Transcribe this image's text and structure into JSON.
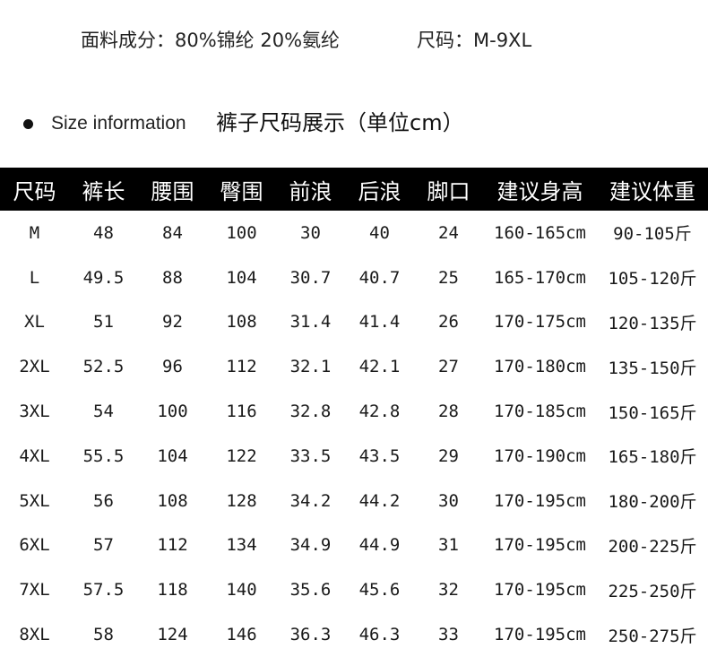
{
  "header": {
    "fabric": "面料成分：80%锦纶  20%氨纶",
    "size_range": "尺码：M-9XL"
  },
  "info": {
    "english": "Size information",
    "chinese": "裤子尺码展示（单位cm）"
  },
  "table": {
    "columns": [
      "尺码",
      "裤长",
      "腰围",
      "臀围",
      "前浪",
      "后浪",
      "脚口",
      "建议身高",
      "建议体重"
    ],
    "rows": [
      [
        "M",
        "48",
        "84",
        "100",
        "30",
        "40",
        "24",
        "160-165cm",
        "90-105斤"
      ],
      [
        "L",
        "49.5",
        "88",
        "104",
        "30.7",
        "40.7",
        "25",
        "165-170cm",
        "105-120斤"
      ],
      [
        "XL",
        "51",
        "92",
        "108",
        "31.4",
        "41.4",
        "26",
        "170-175cm",
        "120-135斤"
      ],
      [
        "2XL",
        "52.5",
        "96",
        "112",
        "32.1",
        "42.1",
        "27",
        "170-180cm",
        "135-150斤"
      ],
      [
        "3XL",
        "54",
        "100",
        "116",
        "32.8",
        "42.8",
        "28",
        "170-185cm",
        "150-165斤"
      ],
      [
        "4XL",
        "55.5",
        "104",
        "122",
        "33.5",
        "43.5",
        "29",
        "170-190cm",
        "165-180斤"
      ],
      [
        "5XL",
        "56",
        "108",
        "128",
        "34.2",
        "44.2",
        "30",
        "170-195cm",
        "180-200斤"
      ],
      [
        "6XL",
        "57",
        "112",
        "134",
        "34.9",
        "44.9",
        "31",
        "170-195cm",
        "200-225斤"
      ],
      [
        "7XL",
        "57.5",
        "118",
        "140",
        "35.6",
        "45.6",
        "32",
        "170-195cm",
        "225-250斤"
      ],
      [
        "8XL",
        "58",
        "124",
        "146",
        "36.3",
        "46.3",
        "33",
        "170-195cm",
        "250-275斤"
      ]
    ]
  }
}
